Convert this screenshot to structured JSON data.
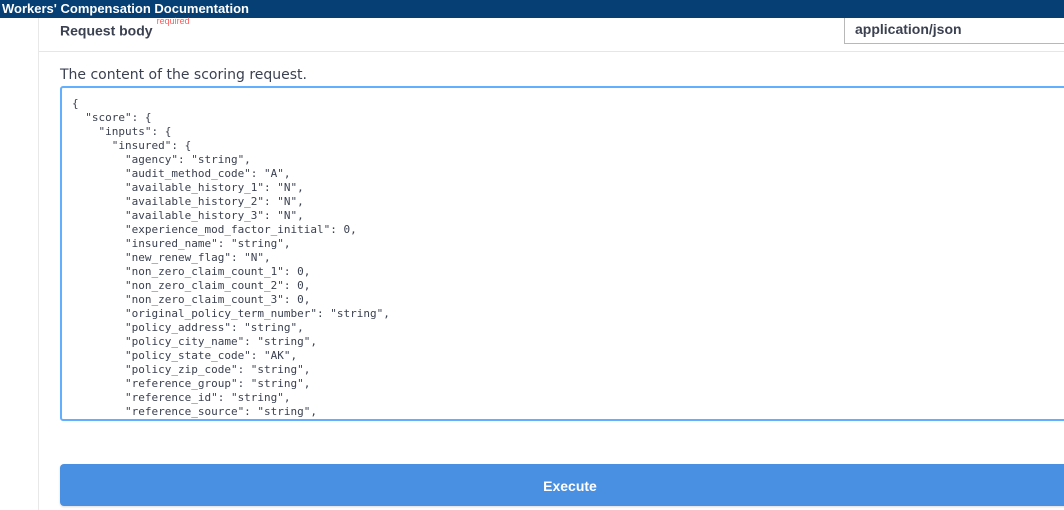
{
  "window": {
    "title": "Workers' Compensation Documentation"
  },
  "request_body": {
    "title": "Request body",
    "required_label": "required",
    "content_type": "application/json",
    "description": "The content of the scoring request.",
    "json_text": "{\n  \"score\": {\n    \"inputs\": {\n      \"insured\": {\n        \"agency\": \"string\",\n        \"audit_method_code\": \"A\",\n        \"available_history_1\": \"N\",\n        \"available_history_2\": \"N\",\n        \"available_history_3\": \"N\",\n        \"experience_mod_factor_initial\": 0,\n        \"insured_name\": \"string\",\n        \"new_renew_flag\": \"N\",\n        \"non_zero_claim_count_1\": 0,\n        \"non_zero_claim_count_2\": 0,\n        \"non_zero_claim_count_3\": 0,\n        \"original_policy_term_number\": \"string\",\n        \"policy_address\": \"string\",\n        \"policy_city_name\": \"string\",\n        \"policy_state_code\": \"AK\",\n        \"policy_zip_code\": \"string\",\n        \"reference_group\": \"string\",\n        \"reference_id\": \"string\",\n        \"reference_source\": \"string\","
  },
  "actions": {
    "execute_label": "Execute"
  },
  "colors": {
    "topbar": "#053f73",
    "editor_border": "#61affe",
    "execute_button": "#4990e2",
    "required": "#ff5d5d"
  }
}
